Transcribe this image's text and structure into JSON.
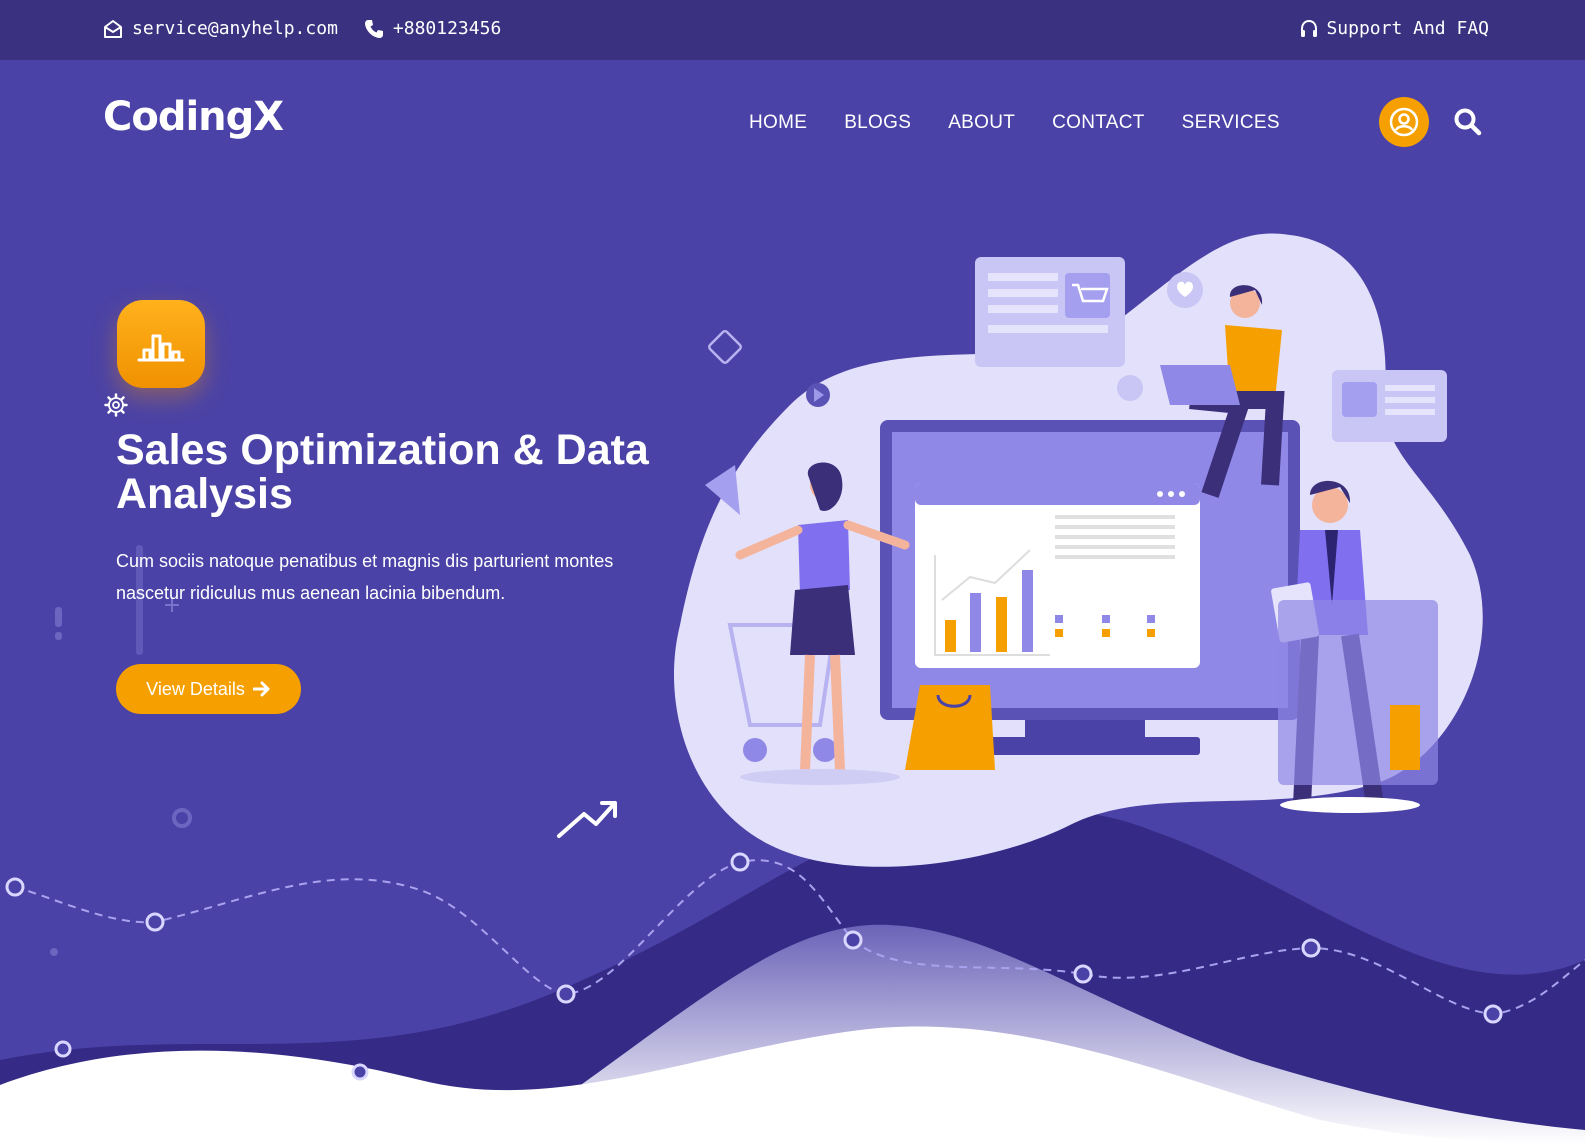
{
  "topbar": {
    "email": "service@anyhelp.com",
    "phone": "+880123456",
    "support_label": "Support And FAQ",
    "icons": [
      "mail-icon",
      "phone-icon",
      "headphones-icon"
    ]
  },
  "nav": {
    "logo": "CodingX",
    "items": [
      {
        "label": "HOME"
      },
      {
        "label": "BLOGS"
      },
      {
        "label": "ABOUT"
      },
      {
        "label": "CONTACT"
      },
      {
        "label": "SERVICES"
      }
    ],
    "icons": [
      "user-icon",
      "search-icon"
    ]
  },
  "hero": {
    "icon": "bar-chart-icon",
    "title": "Sales Optimization & Data Analysis",
    "description": "Cum sociis natoque penatibus et magnis dis parturient montes nascetur ridiculus mus aenean lacinia bibendum.",
    "button_label": "View Details",
    "button_icon": "arrow-right-icon"
  },
  "colors": {
    "background": "#4a42a6",
    "topbar": "#3a3180",
    "accent": "#f5a000",
    "white": "#ffffff"
  }
}
